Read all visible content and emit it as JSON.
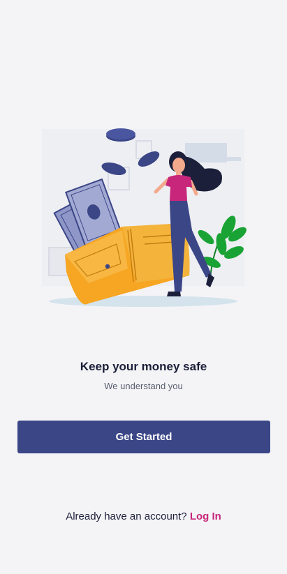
{
  "onboarding": {
    "title": "Keep your money safe",
    "subtitle": "We understand you",
    "primary_button_label": "Get Started",
    "login_prompt": "Already have an account?",
    "login_link_label": "Log In"
  },
  "illustration": {
    "icon": "wallet-money-woman-illustration"
  },
  "colors": {
    "background": "#f4f4f6",
    "primary": "#3b4687",
    "accent": "#c8267a",
    "heading": "#1c1f3a",
    "wallet": "#f6a623",
    "plant": "#1aa335",
    "cash": "#8e97c7"
  }
}
